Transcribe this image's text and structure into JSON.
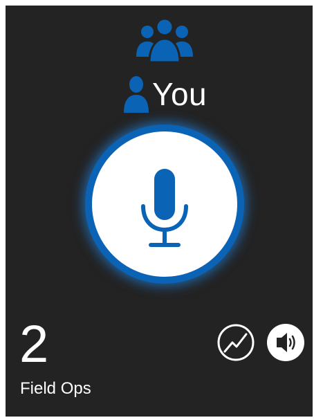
{
  "app": {
    "icons": {
      "group": "group-people-icon",
      "speaker": "person-icon",
      "ptt": "microphone-icon",
      "stats": "activity-chart-icon",
      "volume": "speaker-volume-icon"
    },
    "colors": {
      "panel_background": "#232323",
      "accent_blue": "#0a63b4",
      "text": "#ffffff"
    }
  },
  "speaker": {
    "name": "You"
  },
  "group": {
    "count": "2",
    "name": "Field Ops"
  }
}
